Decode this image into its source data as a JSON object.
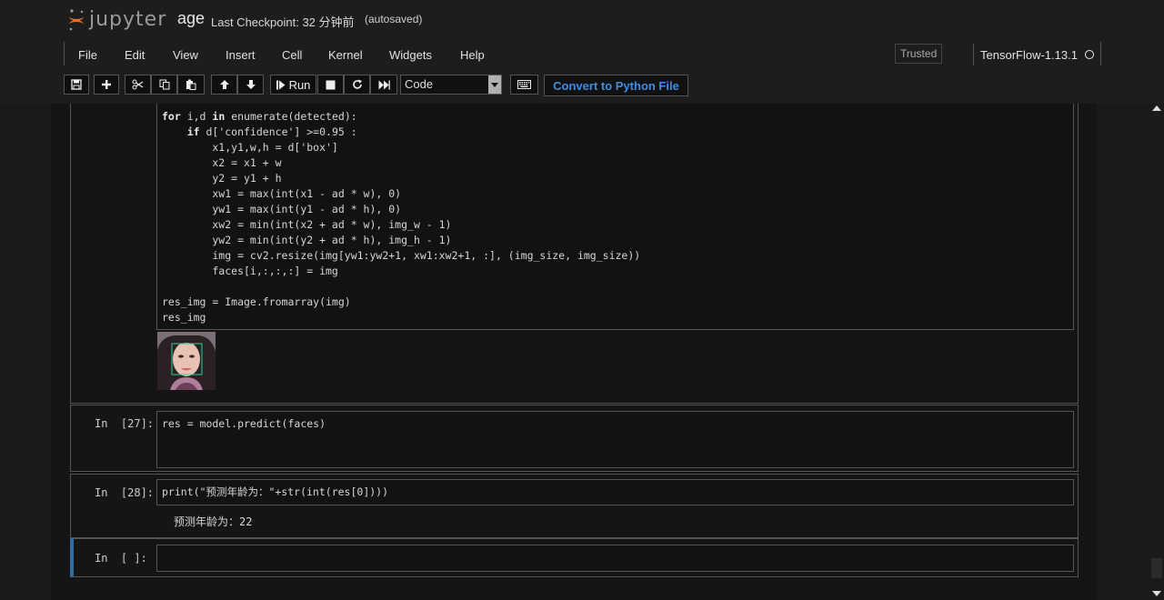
{
  "header": {
    "logo_text": "jupyter",
    "notebook_name": "age",
    "checkpoint": "Last Checkpoint: 32 分钟前",
    "autosave": "(autosaved)"
  },
  "menu": {
    "items": [
      "File",
      "Edit",
      "View",
      "Insert",
      "Cell",
      "Kernel",
      "Widgets",
      "Help"
    ],
    "trusted": "Trusted",
    "kernel": "TensorFlow-1.13.1"
  },
  "toolbar": {
    "run_label": "Run",
    "cell_type": "Code",
    "convert_label": "Convert to Python File"
  },
  "icons": {
    "save": "save-icon",
    "insert": "plus-icon",
    "cut": "scissors-icon",
    "copy": "copy-icon",
    "paste": "paste-icon",
    "move_up": "arrow-up-icon",
    "move_down": "arrow-down-icon",
    "run": "step-forward-icon",
    "stop": "stop-icon",
    "restart": "restart-icon",
    "restart_run_all": "fast-forward-icon",
    "keyboard": "keyboard-icon"
  },
  "colors": {
    "accent": "#2e6da4",
    "convert_text": "#3b8ee8",
    "face_box": "#2fd38f"
  },
  "cells": {
    "cell1": {
      "code_lines": [
        "for i,d in enumerate(detected):",
        "    if d['confidence'] >=0.95 :",
        "        x1,y1,w,h = d['box']",
        "        x2 = x1 + w",
        "        y2 = y1 + h",
        "        xw1 = max(int(x1 - ad * w), 0)",
        "        yw1 = max(int(y1 - ad * h), 0)",
        "        xw2 = min(int(x2 + ad * w), img_w - 1)",
        "        yw2 = min(int(y2 + ad * h), img_h - 1)",
        "        img = cv2.resize(img[yw1:yw2+1, xw1:xw2+1, :], (img_size, img_size))",
        "        faces[i,:,:,:] = img",
        "",
        "res_img = Image.fromarray(img)",
        "res_img"
      ]
    },
    "cell2": {
      "prompt": "In  [27]:",
      "code": "res = model.predict(faces)"
    },
    "cell3": {
      "prompt": "In  [28]:",
      "code": "print(\"预测年龄为：\"+str(int(res[0])))",
      "output": "预测年龄为：22"
    },
    "cell4": {
      "prompt": "In  [ ]:",
      "code": ""
    }
  }
}
